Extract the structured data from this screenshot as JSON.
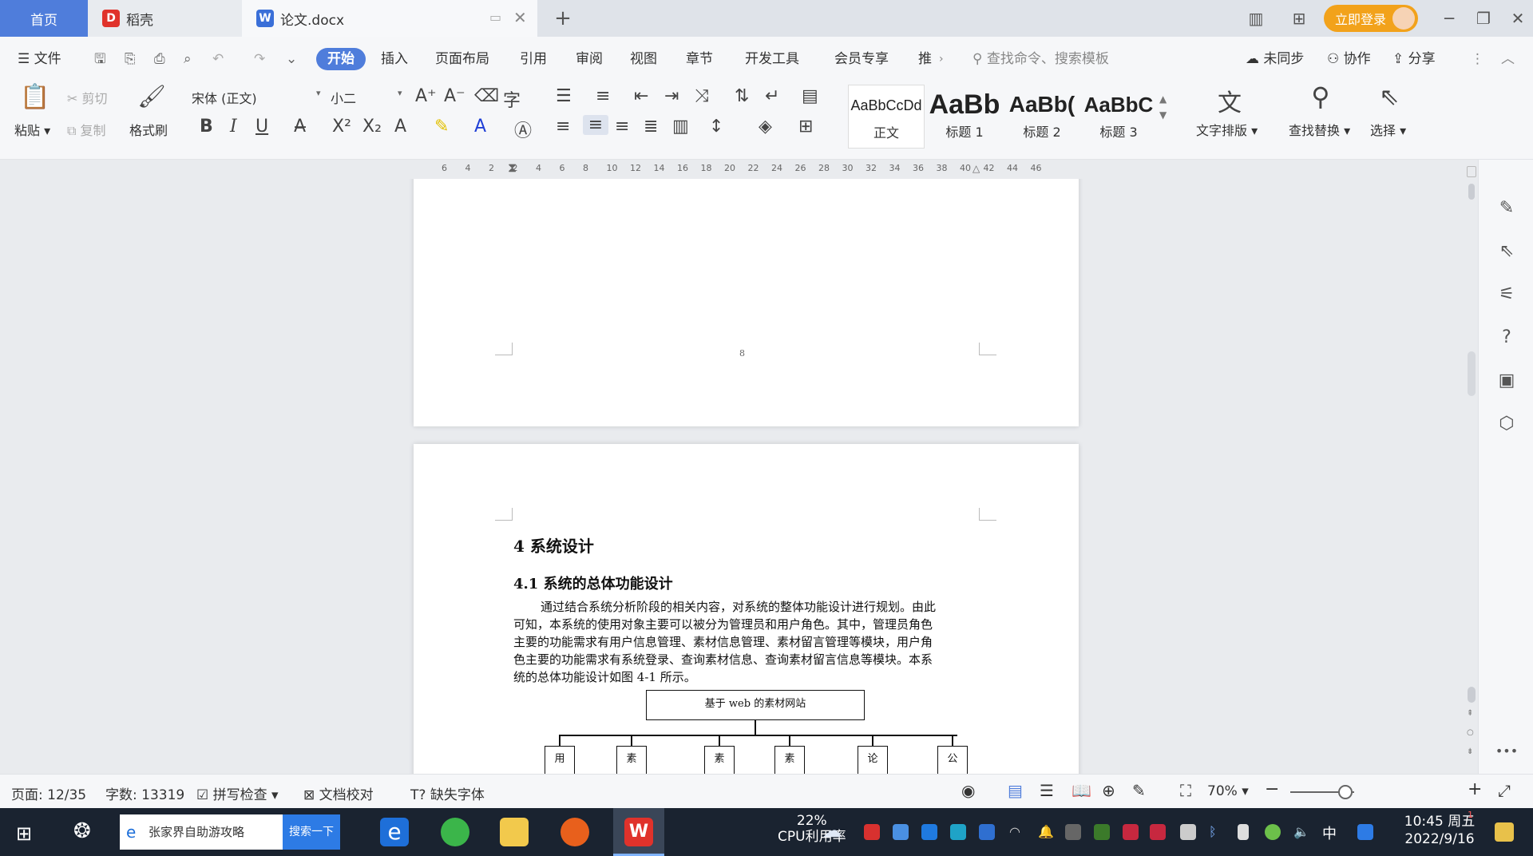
{
  "tabs": {
    "home": "首页",
    "wps": "稻壳",
    "doc": "论文.docx",
    "login": "立即登录"
  },
  "menu": {
    "file": "文件",
    "items": [
      "开始",
      "插入",
      "页面布局",
      "引用",
      "审阅",
      "视图",
      "章节",
      "开发工具",
      "会员专享",
      "推"
    ],
    "search_placeholder": "查找命令、搜索模板",
    "unsync": "未同步",
    "collab": "协作",
    "share": "分享"
  },
  "ribbon": {
    "paste": "粘贴",
    "cut": "剪切",
    "copy": "复制",
    "format_painter": "格式刷",
    "font_name": "宋体 (正文)",
    "font_size": "小二",
    "styles": [
      {
        "sample": "AaBbCcDd",
        "name": "正文"
      },
      {
        "sample": "AaBb",
        "name": "标题 1"
      },
      {
        "sample": "AaBb(",
        "name": "标题 2"
      },
      {
        "sample": "AaBbC",
        "name": "标题 3"
      }
    ],
    "text_layout": "文字排版",
    "find_replace": "查找替换",
    "select": "选择"
  },
  "ruler_ticks": [
    "6",
    "4",
    "2",
    "2",
    "4",
    "6",
    "8",
    "10",
    "12",
    "14",
    "16",
    "18",
    "20",
    "22",
    "24",
    "26",
    "28",
    "30",
    "32",
    "34",
    "36",
    "38",
    "40",
    "42",
    "44",
    "46"
  ],
  "document": {
    "page_number": "8",
    "heading1": "4 系统设计",
    "heading2": "4.1 系统的总体功能设计",
    "paragraph": [
      "通过结合系统分析阶段的相关内容，对系统的整体功能设计进行规划。由此",
      "可知，本系统的使用对象主要可以被分为管理员和用户角色。其中，管理员角色",
      "主要的功能需求有用户信息管理、素材信息管理、素材留言管理等模块，用户角",
      "色主要的功能需求有系统登录、查询素材信息、查询素材留言信息等模块。本系",
      "统的总体功能设计如图 4-1 所示。"
    ],
    "diagram_root": "基于 web 的素材网站",
    "diagram_children": [
      "用",
      "素",
      "素",
      "素",
      "论",
      "公"
    ]
  },
  "status": {
    "page": "页面: 12/35",
    "words": "字数: 13319",
    "spell": "拼写检查",
    "proof": "文档校对",
    "missing_font": "缺失字体",
    "zoom": "70%"
  },
  "taskbar": {
    "search_text": "张家界自助游攻略",
    "search_button": "搜索一下",
    "cpu_percent": "22%",
    "cpu_label": "CPU利用率",
    "ime": "中",
    "time": "10:45 周五",
    "date": "2022/9/16",
    "notify_badge": "1"
  },
  "colors": {
    "accent": "#4f7ddb",
    "login": "#f2a21b",
    "taskbar": "#1a2330",
    "wps_red": "#e0322b"
  }
}
